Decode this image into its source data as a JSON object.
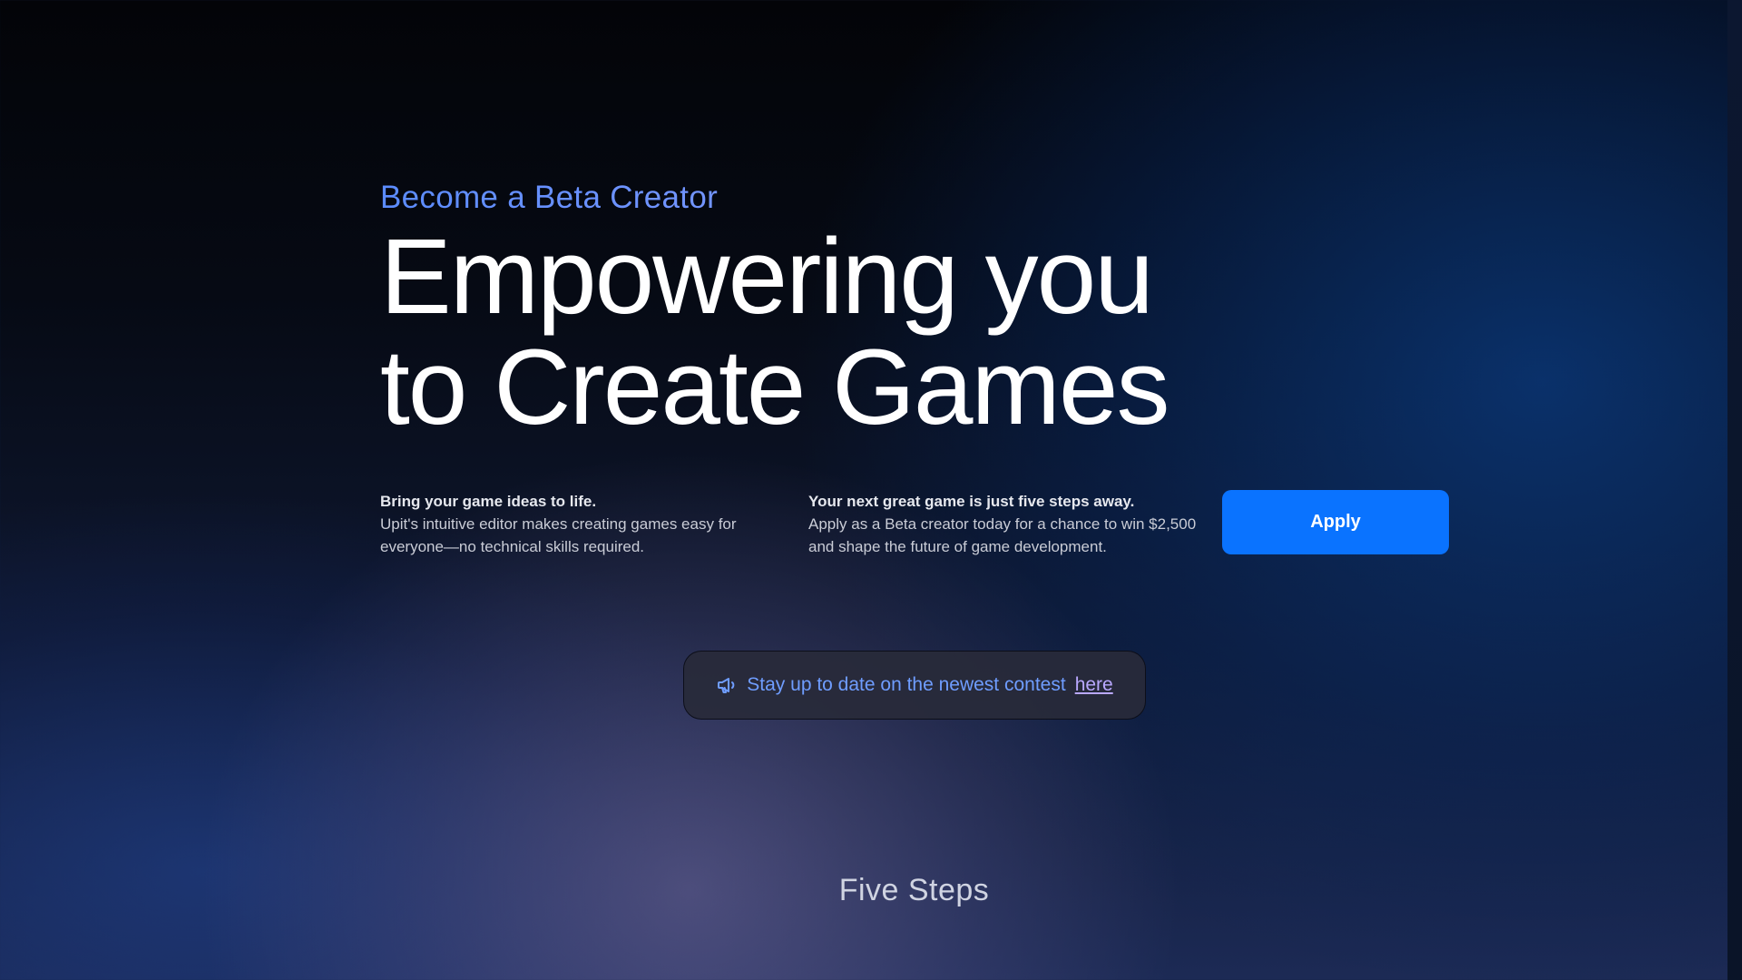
{
  "hero": {
    "eyebrow": "Become a Beta Creator",
    "headline_line1": "Empowering you",
    "headline_line2": "to Create Games"
  },
  "info": [
    {
      "title": "Bring your game ideas to life.",
      "body": "Upit's intuitive editor makes creating games easy for everyone—no technical skills required."
    },
    {
      "title": "Your next great game is just five steps away.",
      "body": "Apply as a Beta creator today for a chance to win $2,500 and shape the future of game development."
    }
  ],
  "cta": {
    "apply_label": "Apply"
  },
  "contest": {
    "icon": "megaphone-icon",
    "text": "Stay up to date on the newest contest",
    "link_label": "here"
  },
  "sections": {
    "five_steps_title": "Five Steps"
  },
  "colors": {
    "accent_blue": "#0a73ff",
    "eyebrow_start": "#5b8cff",
    "eyebrow_end": "#a7a7ff",
    "link": "#b9a8ff"
  }
}
